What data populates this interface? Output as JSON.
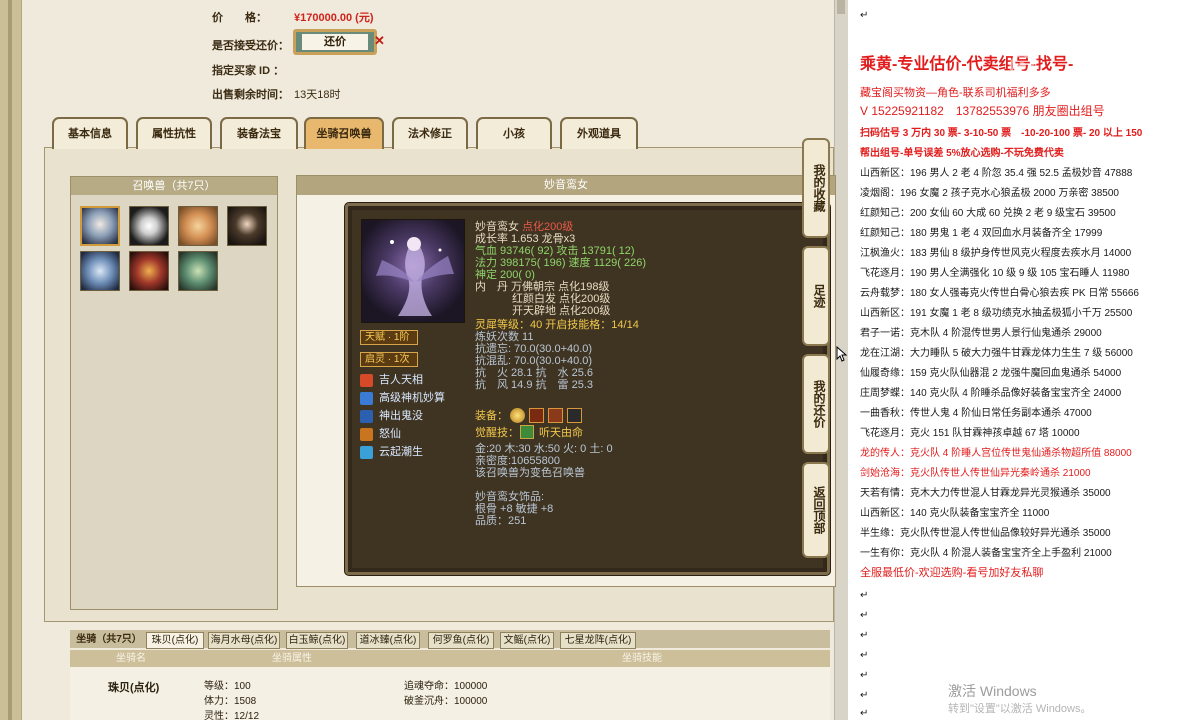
{
  "listing": {
    "price_label": "价　　格：",
    "price_value": "¥170000.00 (元)",
    "counter_label": "是否接受还价：",
    "counter_button": "还价",
    "buyer_id_label": "指定买家 ID ：",
    "remaining_label": "出售剩余时间：",
    "remaining_value": "13天18时"
  },
  "tabs": [
    {
      "label": "基本信息",
      "active": false
    },
    {
      "label": "属性抗性",
      "active": false
    },
    {
      "label": "装备法宝",
      "active": false
    },
    {
      "label": "坐骑召唤兽",
      "active": true
    },
    {
      "label": "法术修正",
      "active": false
    },
    {
      "label": "小孩",
      "active": false
    },
    {
      "label": "外观道具",
      "active": false
    }
  ],
  "pets_panel": {
    "title": "召唤兽（共7只）",
    "pets": [
      {
        "icon": "pet-portrait-white-hair"
      },
      {
        "icon": "pet-portrait-panda"
      },
      {
        "icon": "pet-portrait-fox"
      },
      {
        "icon": "pet-portrait-girl"
      },
      {
        "icon": "pet-portrait-ice-demon"
      },
      {
        "icon": "pet-portrait-red-demon"
      },
      {
        "icon": "pet-portrait-beast"
      }
    ]
  },
  "detail": {
    "title": "妙音鸾女",
    "name": "妙音鸾女",
    "enhance": "点化200级",
    "growth": "成长率 1.653 龙骨x3",
    "hp": "气血 93746( 92) 攻击 13791( 12)",
    "mp": "法力 398175( 196) 速度 1129( 226)",
    "spirit": "神定 200( 0)",
    "inner_dan_1": "内　丹 万佛朝宗 点化198级",
    "inner_dan_2": "红颜白发 点化200级",
    "inner_dan_3": "开天辟地 点化200级",
    "lingxi": "灵犀等级：40 开启技能格：14/14",
    "refine_count": "炼妖次数 11",
    "resist_forget": "抗遗忘: 70.0(30.0+40.0)",
    "resist_chaos": "抗混乱: 70.0(30.0+40.0)",
    "resist_fire_water": "抗　火 28.1 抗　水 25.6",
    "resist_wind_thunder": "抗　风 14.9 抗　雷 25.3",
    "equipment_label": "装备：",
    "awaken_label": "觉醒技：",
    "awaken_skill": "听天由命",
    "elements": "金:20 木:30 水:50 火: 0 土: 0",
    "affinity": "亲密度:10655800",
    "transformed": "该召唤兽为变色召唤兽",
    "ornament_title": "妙音鸾女饰品:",
    "ornament_stats": "根骨 +8 敏捷 +8",
    "ornament_quality": "品质：251",
    "talent_label": "天赋 · 1阶",
    "spirit_label": "启灵 · 1次",
    "skills": [
      {
        "name": "吉人天相",
        "icon": "skill-luck-icon",
        "color": "#d64a2a"
      },
      {
        "name": "高级神机妙算",
        "icon": "skill-strategy-icon",
        "color": "#3a7bd5"
      },
      {
        "name": "神出鬼没",
        "icon": "skill-stealth-icon",
        "color": "#2d5fb0"
      },
      {
        "name": "怒仙",
        "icon": "skill-fury-icon",
        "color": "#c9751f"
      },
      {
        "name": "云起潮生",
        "icon": "skill-tide-icon",
        "color": "#3aa0d8"
      }
    ]
  },
  "side_buttons": [
    {
      "label": "我的收藏"
    },
    {
      "label": "足迹"
    },
    {
      "label": "我的还价"
    },
    {
      "label": "返回顶部"
    }
  ],
  "mounts": {
    "tabs": [
      {
        "label": "坐骑（共7只）",
        "active": false
      },
      {
        "label": "珠贝(点化)",
        "active": true
      },
      {
        "label": "海月水母(点化)",
        "active": false
      },
      {
        "label": "白玉鲸(点化)",
        "active": false
      },
      {
        "label": "道冰臻(点化)",
        "active": false
      },
      {
        "label": "何罗鱼(点化)",
        "active": false
      },
      {
        "label": "文鳐(点化)",
        "active": false
      },
      {
        "label": "七星龙阵(点化)",
        "active": false
      }
    ],
    "headers": [
      "坐骑名",
      "坐骑属性",
      "坐骑技能"
    ],
    "name": "珠贝(点化)",
    "level": "等级：100",
    "strength": "体力：1508",
    "spirit": "灵性：12/12",
    "skill_1": "追魂夺命：100000",
    "skill_2": "破釜沉舟：100000"
  },
  "ad": {
    "title": "乘黄-专业估价-代卖组号-找号-",
    "lines": [
      {
        "text": "藏宝阁买物资—角色-联系司机福利多多",
        "red": true,
        "bold": false,
        "size": 11
      },
      {
        "text": "V 15225921182　13782553976 朋友圈出组号",
        "red": true,
        "bold": false,
        "size": 12
      },
      {
        "text": "扫码估号 3 万内 30 票- 3-10-50 票　-10-20-100 票- 20 以上 150",
        "red": true,
        "bold": true,
        "size": 10
      },
      {
        "text": "帮出组号-单号误差 5%放心选购-不玩免费代卖",
        "red": true,
        "bold": true,
        "size": 10
      },
      {
        "text": "山西新区：196 男人 2 老 4 阶忽 35.4 强 52.5 孟极妙音 47888",
        "red": false,
        "bold": false,
        "size": 10
      },
      {
        "text": "凌烟阁：196 女魔 2 孩子克水心狼孟极 2000 万亲密 38500",
        "red": false,
        "bold": false,
        "size": 10
      },
      {
        "text": "红颜知己：200 女仙 60 大成 60 兑换 2 老 9 级宝石 39500",
        "red": false,
        "bold": false,
        "size": 10
      },
      {
        "text": "红颜知己：180 男鬼 1 老 4 双回血水月装备齐全 17999",
        "red": false,
        "bold": false,
        "size": 10
      },
      {
        "text": "江枫渔火：183 男仙 8 级护身传世风克火程度去疾水月 14000",
        "red": false,
        "bold": false,
        "size": 10
      },
      {
        "text": "飞花逐月：190 男人全满强化 10 级 9 级 105 宝石睡人 11980",
        "red": false,
        "bold": false,
        "size": 10
      },
      {
        "text": "云舟载梦：180 女人强毒克火传世白骨心狼去疾 PK 日常 55666",
        "red": false,
        "bold": false,
        "size": 10
      },
      {
        "text": "山西新区：191 女魔 1 老 8 级功绩克水抽孟极狐小千万 25500",
        "red": false,
        "bold": false,
        "size": 10
      },
      {
        "text": "君子一诺：克木队 4 阶混传世男人景行仙鬼通杀 29000",
        "red": false,
        "bold": false,
        "size": 10
      },
      {
        "text": "龙在江湖：大力睡队 5 破大力强牛甘霖龙体力生生 7 级 56000",
        "red": false,
        "bold": false,
        "size": 10
      },
      {
        "text": "仙履奇缘：159 克火队仙器混 2 龙强牛魔回血鬼通杀 54000",
        "red": false,
        "bold": false,
        "size": 10
      },
      {
        "text": "庄周梦蝶：140 克火队 4 阶睡杀品像好装备宝宝齐全 24000",
        "red": false,
        "bold": false,
        "size": 10
      },
      {
        "text": "一曲香秋：传世人鬼 4 阶仙日常任务副本通杀 47000",
        "red": false,
        "bold": false,
        "size": 10
      },
      {
        "text": "飞花逐月：克火 151 队甘霖神孩卓越 67 塔 10000",
        "red": false,
        "bold": false,
        "size": 10
      },
      {
        "text": "龙的传人：克火队 4 阶睡人宫位传世鬼仙通杀物超所值 88000",
        "red": true,
        "bold": false,
        "size": 10
      },
      {
        "text": "剑始沧海：克火队传世人传世仙异光秦岭通杀 21000",
        "red": true,
        "bold": false,
        "size": 10
      },
      {
        "text": "天若有情：克木大力传世混人甘霖龙异光灵猴通杀 35000",
        "red": false,
        "bold": false,
        "size": 10
      },
      {
        "text": "山西新区：140 克火队装备宝宝齐全 11000",
        "red": false,
        "bold": false,
        "size": 10
      },
      {
        "text": "半生缘：克火队传世混人传世仙品像较好异光通杀 35000",
        "red": false,
        "bold": false,
        "size": 10
      },
      {
        "text": "一生有你：克火队 4 阶混人装备宝宝齐全上手盈利 21000",
        "red": false,
        "bold": false,
        "size": 10
      },
      {
        "text": "全服最低价-欢迎选购-看号加好友私聊",
        "red": true,
        "bold": false,
        "size": 11
      }
    ],
    "arrow_glyph": "↵",
    "watermark": "激活 Windows",
    "watermark_sub": "转到\"设置\"以激活 Windows。"
  }
}
